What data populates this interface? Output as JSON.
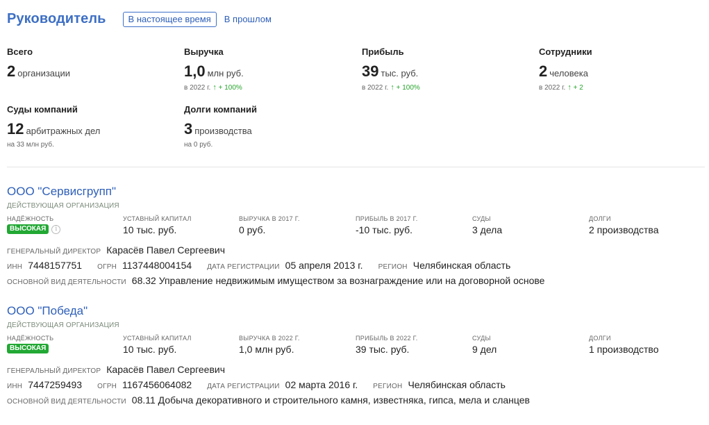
{
  "header": {
    "title": "Руководитель",
    "tab_current": "В настоящее время",
    "tab_past": "В прошлом"
  },
  "stats": {
    "total": {
      "label": "Всего",
      "value": "2",
      "unit": "организации"
    },
    "revenue": {
      "label": "Выручка",
      "value": "1,0",
      "unit": "млн руб.",
      "sub_prefix": "в 2022 г.",
      "delta": "+ 100%"
    },
    "profit": {
      "label": "Прибыль",
      "value": "39",
      "unit": "тыс. руб.",
      "sub_prefix": "в 2022 г.",
      "delta": "+ 100%"
    },
    "employees": {
      "label": "Сотрудники",
      "value": "2",
      "unit": "человека",
      "sub_prefix": "в 2022 г.",
      "delta": "+ 2"
    },
    "courts": {
      "label": "Суды компаний",
      "value": "12",
      "unit": "арбитражных дел",
      "sub": "на 33 млн руб."
    },
    "debts": {
      "label": "Долги компаний",
      "value": "3",
      "unit": "производства",
      "sub": "на 0 руб."
    }
  },
  "orgs": [
    {
      "name": "ООО \"Сервисгрупп\"",
      "status": "ДЕЙСТВУЮЩАЯ ОРГАНИЗАЦИЯ",
      "reliability_label": "Надёжность",
      "reliability": "ВЫСОКАЯ",
      "capital_label": "Уставный капитал",
      "capital": "10 тыс. руб.",
      "revenue_label": "Выручка в 2017 г.",
      "revenue": "0 руб.",
      "profit_label": "Прибыль в 2017 г.",
      "profit": "-10 тыс. руб.",
      "courts_label": "Суды",
      "courts": "3 дела",
      "debts_label": "Долги",
      "debts": "2 производства",
      "director_label": "Генеральный директор",
      "director": "Карасёв Павел Сергеевич",
      "inn_label": "ИНН",
      "inn": "7448157751",
      "ogrn_label": "ОГРН",
      "ogrn": "1137448004154",
      "regdate_label": "Дата регистрации",
      "regdate": "05 апреля 2013 г.",
      "region_label": "Регион",
      "region": "Челябинская область",
      "activity_label": "Основной вид деятельности",
      "activity": "68.32 Управление недвижимым имуществом за вознаграждение или на договорной основе"
    },
    {
      "name": "ООО \"Победа\"",
      "status": "ДЕЙСТВУЮЩАЯ ОРГАНИЗАЦИЯ",
      "reliability_label": "Надёжность",
      "reliability": "ВЫСОКАЯ",
      "capital_label": "Уставный капитал",
      "capital": "10 тыс. руб.",
      "revenue_label": "Выручка в 2022 г.",
      "revenue": "1,0 млн руб.",
      "profit_label": "Прибыль в 2022 г.",
      "profit": "39 тыс. руб.",
      "courts_label": "Суды",
      "courts": "9 дел",
      "debts_label": "Долги",
      "debts": "1 производство",
      "director_label": "Генеральный директор",
      "director": "Карасёв Павел Сергеевич",
      "inn_label": "ИНН",
      "inn": "7447259493",
      "ogrn_label": "ОГРН",
      "ogrn": "1167456064082",
      "regdate_label": "Дата регистрации",
      "regdate": "02 марта 2016 г.",
      "region_label": "Регион",
      "region": "Челябинская область",
      "activity_label": "Основной вид деятельности",
      "activity": "08.11 Добыча декоративного и строительного камня, известняка, гипса, мела и сланцев"
    }
  ],
  "icons": {
    "delta": "arrow-up-icon",
    "info": "info-icon"
  },
  "colors": {
    "accent": "#3d6fc4",
    "link": "#2e5fb8",
    "positive": "#2aa52f",
    "badge": "#22a834"
  }
}
